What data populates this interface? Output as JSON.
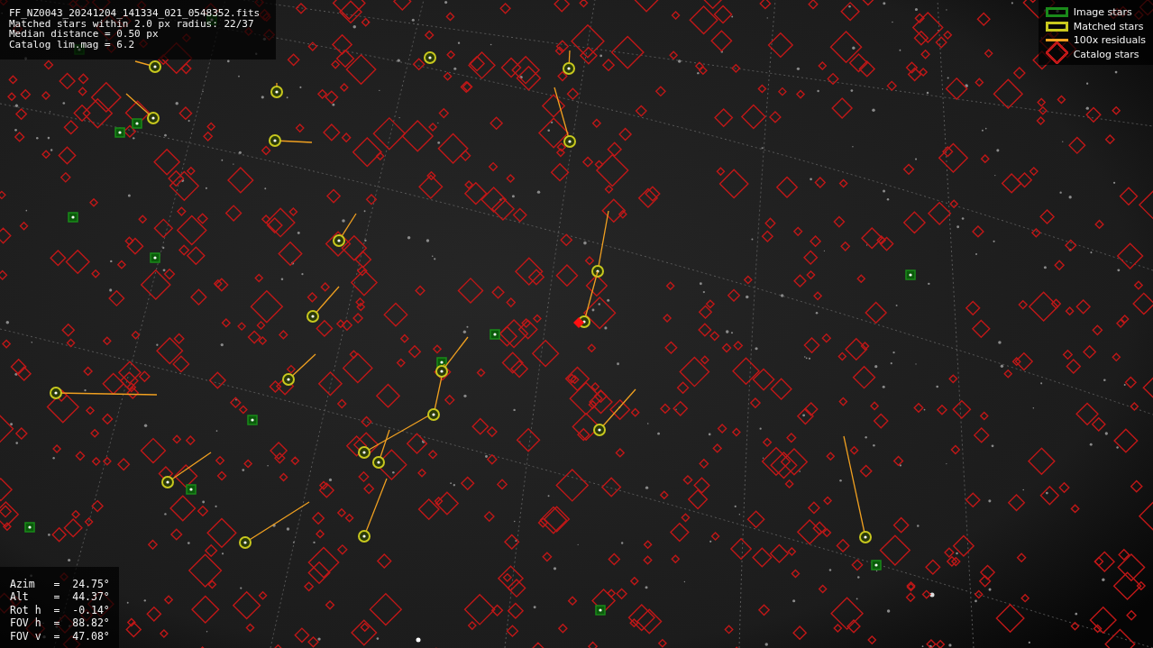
{
  "header": {
    "lines": [
      "FF_NZ0043_20241204_141334_021_0548352.fits",
      "Matched stars within 2.0 px radius: 22/37",
      "Median distance = 0.50 px",
      "Catalog lim.mag = 6.2"
    ]
  },
  "legend": [
    {
      "kind": "box",
      "color": "#1a8a1a",
      "label": "Image stars"
    },
    {
      "kind": "box",
      "color": "#c8c81e",
      "label": "Matched stars"
    },
    {
      "kind": "line",
      "color": "#f0a020",
      "label": "100x residuals"
    },
    {
      "kind": "diamond",
      "color": "#c01818",
      "label": "Catalog stars"
    }
  ],
  "pointing": {
    "lines": [
      "Azim   =  24.75°",
      "Alt    =  44.37°",
      "Rot h  =  -0.14°",
      "FOV h  =  88.82°",
      "FOV v  =  47.08°"
    ]
  }
}
